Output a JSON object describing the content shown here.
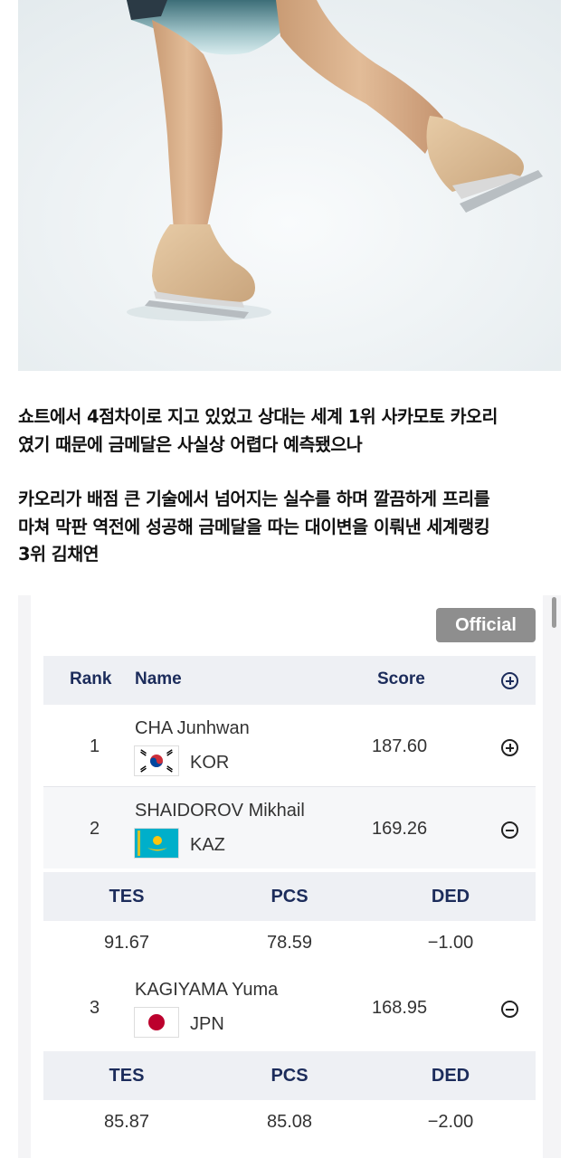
{
  "article": {
    "paragraph1": "쇼트에서 4점차이로 지고 있었고 상대는 세계 1위 사카모토 카오리\n였기 때문에 금메달은 사실상 어렵다 예측됐으나",
    "paragraph2": "카오리가 배점 큰 기술에서 넘어지는 실수를 하며 깔끔하게 프리를\n마쳐 막판 역전에 성공해 금메달을 따는 대이변을 이뤄낸 세계랭킹\n3위 김채연"
  },
  "results": {
    "badge": "Official",
    "columns": {
      "rank": "Rank",
      "name": "Name",
      "score": "Score"
    },
    "detail_columns": {
      "tes": "TES",
      "pcs": "PCS",
      "ded": "DED"
    },
    "athletes": [
      {
        "rank": "1",
        "name": "CHA Junhwan",
        "country": "KOR",
        "flag": "korea-flag-icon",
        "score": "187.60",
        "expanded": false
      },
      {
        "rank": "2",
        "name": "SHAIDOROV Mikhail",
        "country": "KAZ",
        "flag": "kazakhstan-flag-icon",
        "score": "169.26",
        "expanded": true,
        "tes": "91.67",
        "pcs": "78.59",
        "ded": "−1.00"
      },
      {
        "rank": "3",
        "name": "KAGIYAMA Yuma",
        "country": "JPN",
        "flag": "japan-flag-icon",
        "score": "168.95",
        "expanded": true,
        "tes": "85.87",
        "pcs": "85.08",
        "ded": "−2.00"
      }
    ]
  },
  "colors": {
    "header_text": "#1c2c5b",
    "badge_bg": "#8e8e8e",
    "header_bg": "#eef0f4"
  }
}
